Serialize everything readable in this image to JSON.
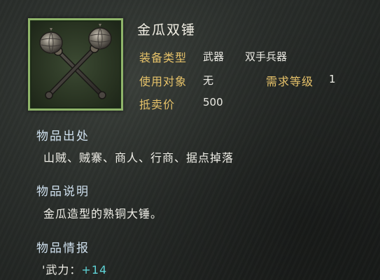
{
  "item": {
    "name": "金瓜双锤",
    "icon": "double-hammer-icon"
  },
  "attributes": {
    "equip_type_label": "装备类型",
    "equip_type_value": "武器",
    "equip_subtype_value": "双手兵器",
    "target_label": "使用对象",
    "target_value": "无",
    "level_label": "需求等级",
    "level_value": "1",
    "price_label": "抵卖价",
    "price_value": "500"
  },
  "source": {
    "title": "物品出处",
    "text": "山贼、贼寨、商人、行商、据点掉落"
  },
  "description": {
    "title": "物品说明",
    "text": "金瓜造型的熟铜大锤。"
  },
  "intel": {
    "title": "物品情报",
    "stat_prefix": "'",
    "stat_label": "武力：",
    "stat_value": "+14"
  },
  "colors": {
    "label_gold": "#e7c36a",
    "section_blue": "#cfe0ee",
    "bonus_cyan": "#5fd3d6",
    "frame_green": "#8fb56a"
  }
}
